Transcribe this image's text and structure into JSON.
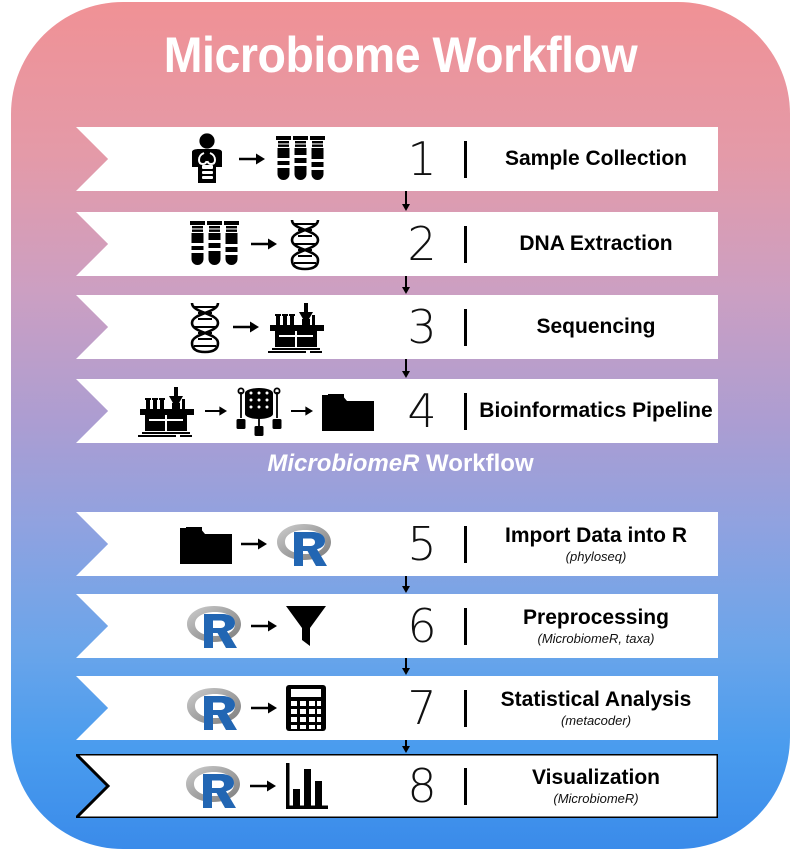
{
  "title": "Microbiome Workflow",
  "section_label": {
    "italic_part": "MicrobiomeR",
    "plain_part": " Workflow"
  },
  "colors": {
    "gradient_top": "#f09195",
    "gradient_mid": "#ab9dd2",
    "gradient_bottom": "#3a8bea",
    "banner_fill": "#ffffff",
    "text_dark": "#000000",
    "text_light": "#ffffff",
    "r_logo_blue": "#2266b3",
    "r_logo_gray": "#9a9a9a"
  },
  "steps": [
    {
      "number": "1",
      "label": "Sample Collection",
      "sublabel": "",
      "icons": [
        "person-torso-icon",
        "arrow-right-icon",
        "test-tubes-icon"
      ],
      "outlined": false
    },
    {
      "number": "2",
      "label": "DNA Extraction",
      "sublabel": "",
      "icons": [
        "test-tubes-icon",
        "arrow-right-icon",
        "dna-helix-icon"
      ],
      "outlined": false
    },
    {
      "number": "3",
      "label": "Sequencing",
      "sublabel": "",
      "icons": [
        "dna-helix-icon",
        "arrow-right-icon",
        "lab-bench-icon"
      ],
      "outlined": false
    },
    {
      "number": "4",
      "label": "Bioinformatics Pipeline",
      "sublabel": "",
      "icons": [
        "lab-bench-icon",
        "arrow-right-icon",
        "server-network-icon",
        "arrow-right-icon",
        "folder-icon"
      ],
      "outlined": false
    },
    {
      "number": "5",
      "label": "Import Data into R",
      "sublabel": "(phyloseq)",
      "icons": [
        "folder-icon",
        "arrow-right-icon",
        "r-logo-icon"
      ],
      "outlined": false
    },
    {
      "number": "6",
      "label": "Preprocessing",
      "sublabel": "(MicrobiomeR, taxa)",
      "icons": [
        "r-logo-icon",
        "arrow-right-icon",
        "funnel-icon"
      ],
      "outlined": false
    },
    {
      "number": "7",
      "label": "Statistical Analysis",
      "sublabel": "(metacoder)",
      "icons": [
        "r-logo-icon",
        "arrow-right-icon",
        "calculator-icon"
      ],
      "outlined": false
    },
    {
      "number": "8",
      "label": "Visualization",
      "sublabel": "(MicrobiomeR)",
      "icons": [
        "r-logo-icon",
        "arrow-right-icon",
        "bar-chart-icon"
      ],
      "outlined": true
    }
  ]
}
